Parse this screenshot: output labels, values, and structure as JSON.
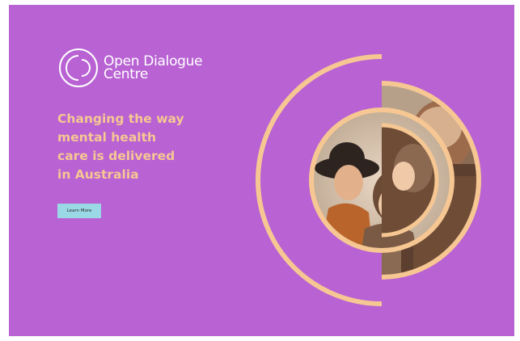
{
  "brand": {
    "name_line1": "Open Dialogue",
    "name_line2": "Centre"
  },
  "hero": {
    "headline_lines": [
      "Changing the way",
      "mental health",
      "care is delivered",
      "in Australia"
    ],
    "cta_label": "Learn More"
  },
  "colors": {
    "background": "#b862d3",
    "accent": "#f6c793",
    "button": "#9bd8e6",
    "logo": "#ffffff"
  },
  "icons": {
    "logo": "open-dialogue-circles-icon"
  }
}
